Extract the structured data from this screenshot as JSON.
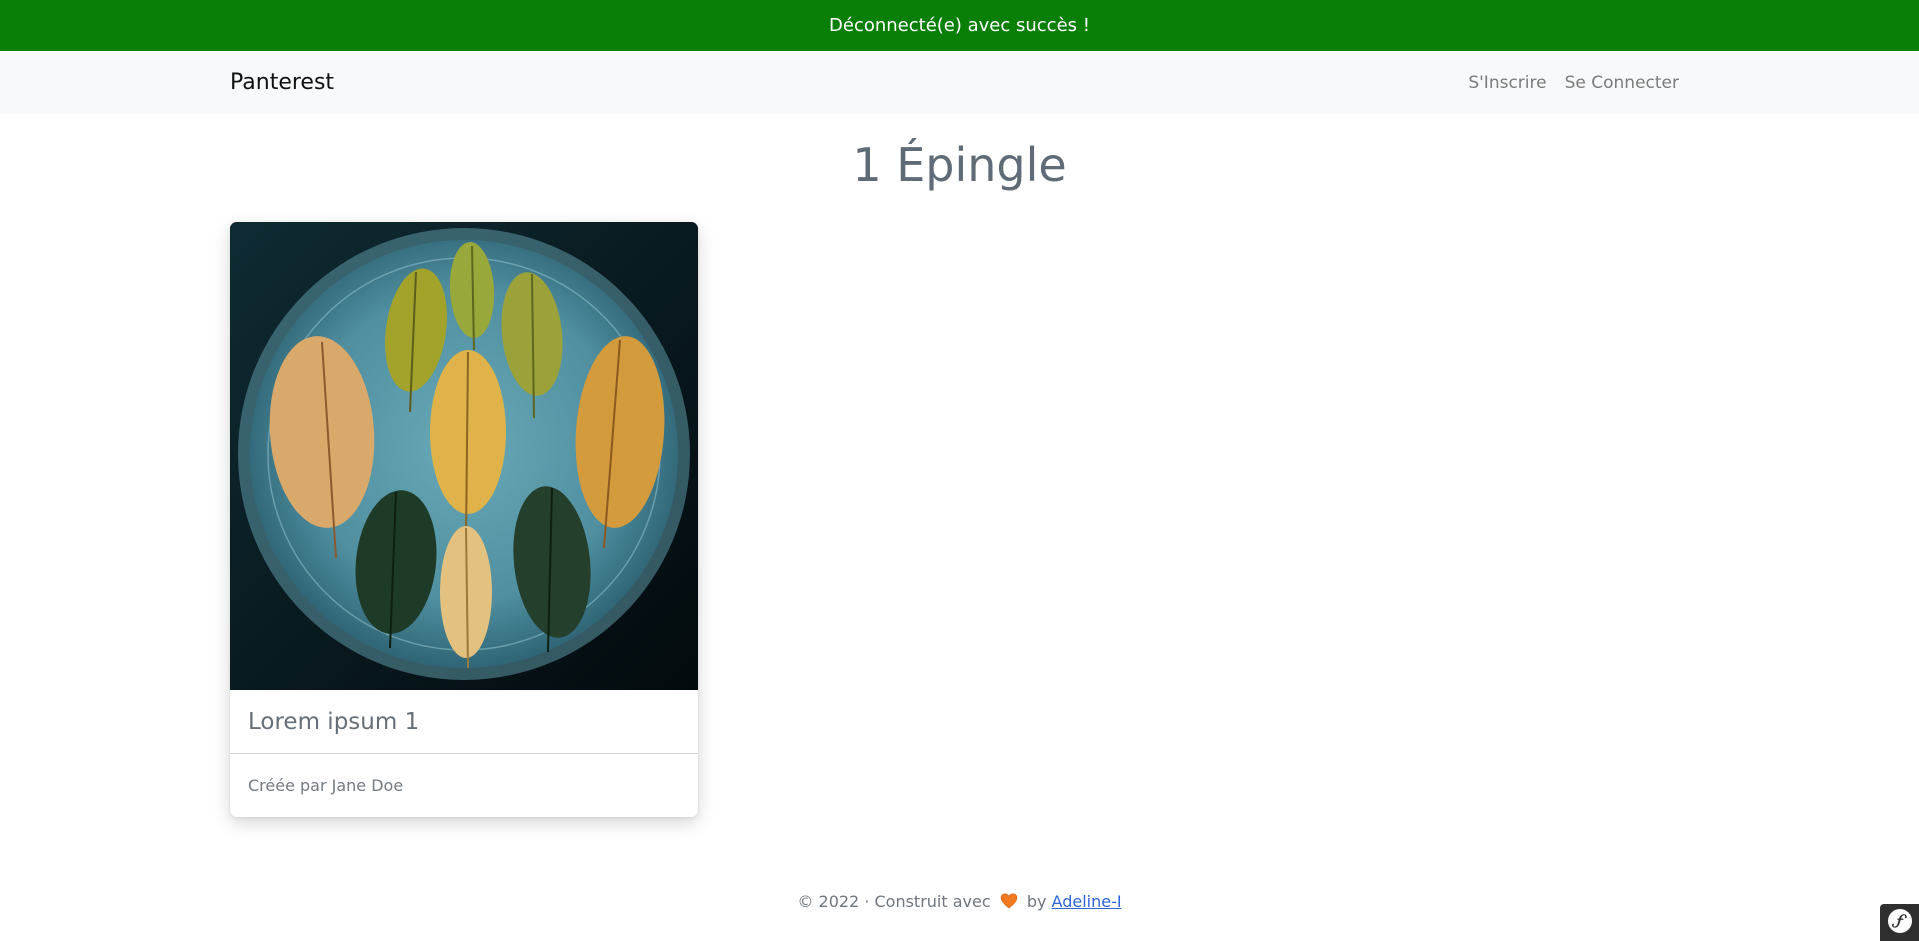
{
  "flash": {
    "message": "Déconnecté(e) avec succès !",
    "color": "#0a7f07"
  },
  "navbar": {
    "brand": "Panterest",
    "links": [
      {
        "label": "S'Inscrire"
      },
      {
        "label": "Se Connecter"
      }
    ]
  },
  "main": {
    "title": "1 Épingle",
    "pins": [
      {
        "title": "Lorem ipsum 1",
        "meta": "Créée par Jane Doe",
        "image_icon": "leaves-plate-photo"
      }
    ]
  },
  "footer": {
    "prefix": "© 2022 · Construit avec",
    "heart_icon": "heart-icon",
    "by": "by",
    "author_link": "Adeline-I",
    "link_color": "#2f65d9"
  },
  "debug_toolbar": {
    "icon": "symfony-icon"
  }
}
